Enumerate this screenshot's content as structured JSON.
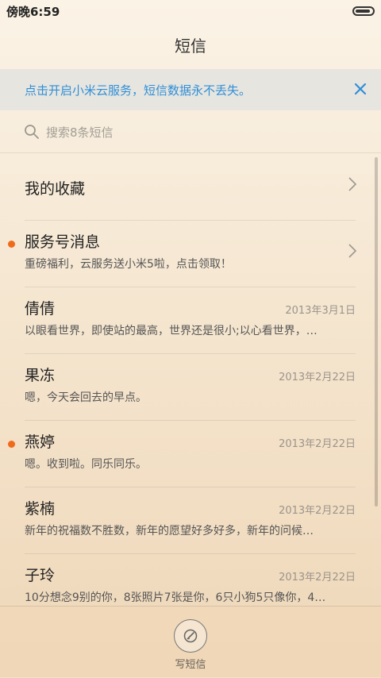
{
  "status_bar": {
    "time": "傍晚6:59",
    "battery_level": 0.9
  },
  "header": {
    "title": "短信"
  },
  "banner": {
    "text": "点击开启小米云服务，短信数据永不丢失。",
    "close_icon": "close-icon",
    "color": "#2f8fd8"
  },
  "search": {
    "placeholder": "搜索8条短信",
    "icon": "search-icon"
  },
  "conversations": [
    {
      "name": "我的收藏",
      "preview": "",
      "date": "",
      "unread": false,
      "has_chevron": true
    },
    {
      "name": "服务号消息",
      "preview": "重磅福利，云服务送小米5啦，点击领取！",
      "date": "",
      "unread": true,
      "has_chevron": true
    },
    {
      "name": "倩倩",
      "preview": "以眼看世界，即使站的最高，世界还是很小;以心看世界，…",
      "date": "2013年3月1日",
      "unread": false,
      "has_chevron": false
    },
    {
      "name": "果冻",
      "preview": "嗯，今天会回去的早点。",
      "date": "2013年2月22日",
      "unread": false,
      "has_chevron": false
    },
    {
      "name": "燕婷",
      "preview": "嗯。收到啦。同乐同乐。",
      "date": "2013年2月22日",
      "unread": true,
      "has_chevron": false
    },
    {
      "name": "紫楠",
      "preview": "新年的祝福数不胜数，新年的愿望好多好多，新年的问候…",
      "date": "2013年2月22日",
      "unread": false,
      "has_chevron": false
    },
    {
      "name": "子玲",
      "preview": "10分想念9别的你，8张照片7张是你，6只小狗5只像你，4…",
      "date": "2013年2月22日",
      "unread": false,
      "has_chevron": false
    }
  ],
  "bottom_bar": {
    "compose_label": "写短信",
    "compose_icon": "compose-icon"
  },
  "colors": {
    "accent": "#2f8fd8",
    "unread_dot": "#f06a1c"
  }
}
